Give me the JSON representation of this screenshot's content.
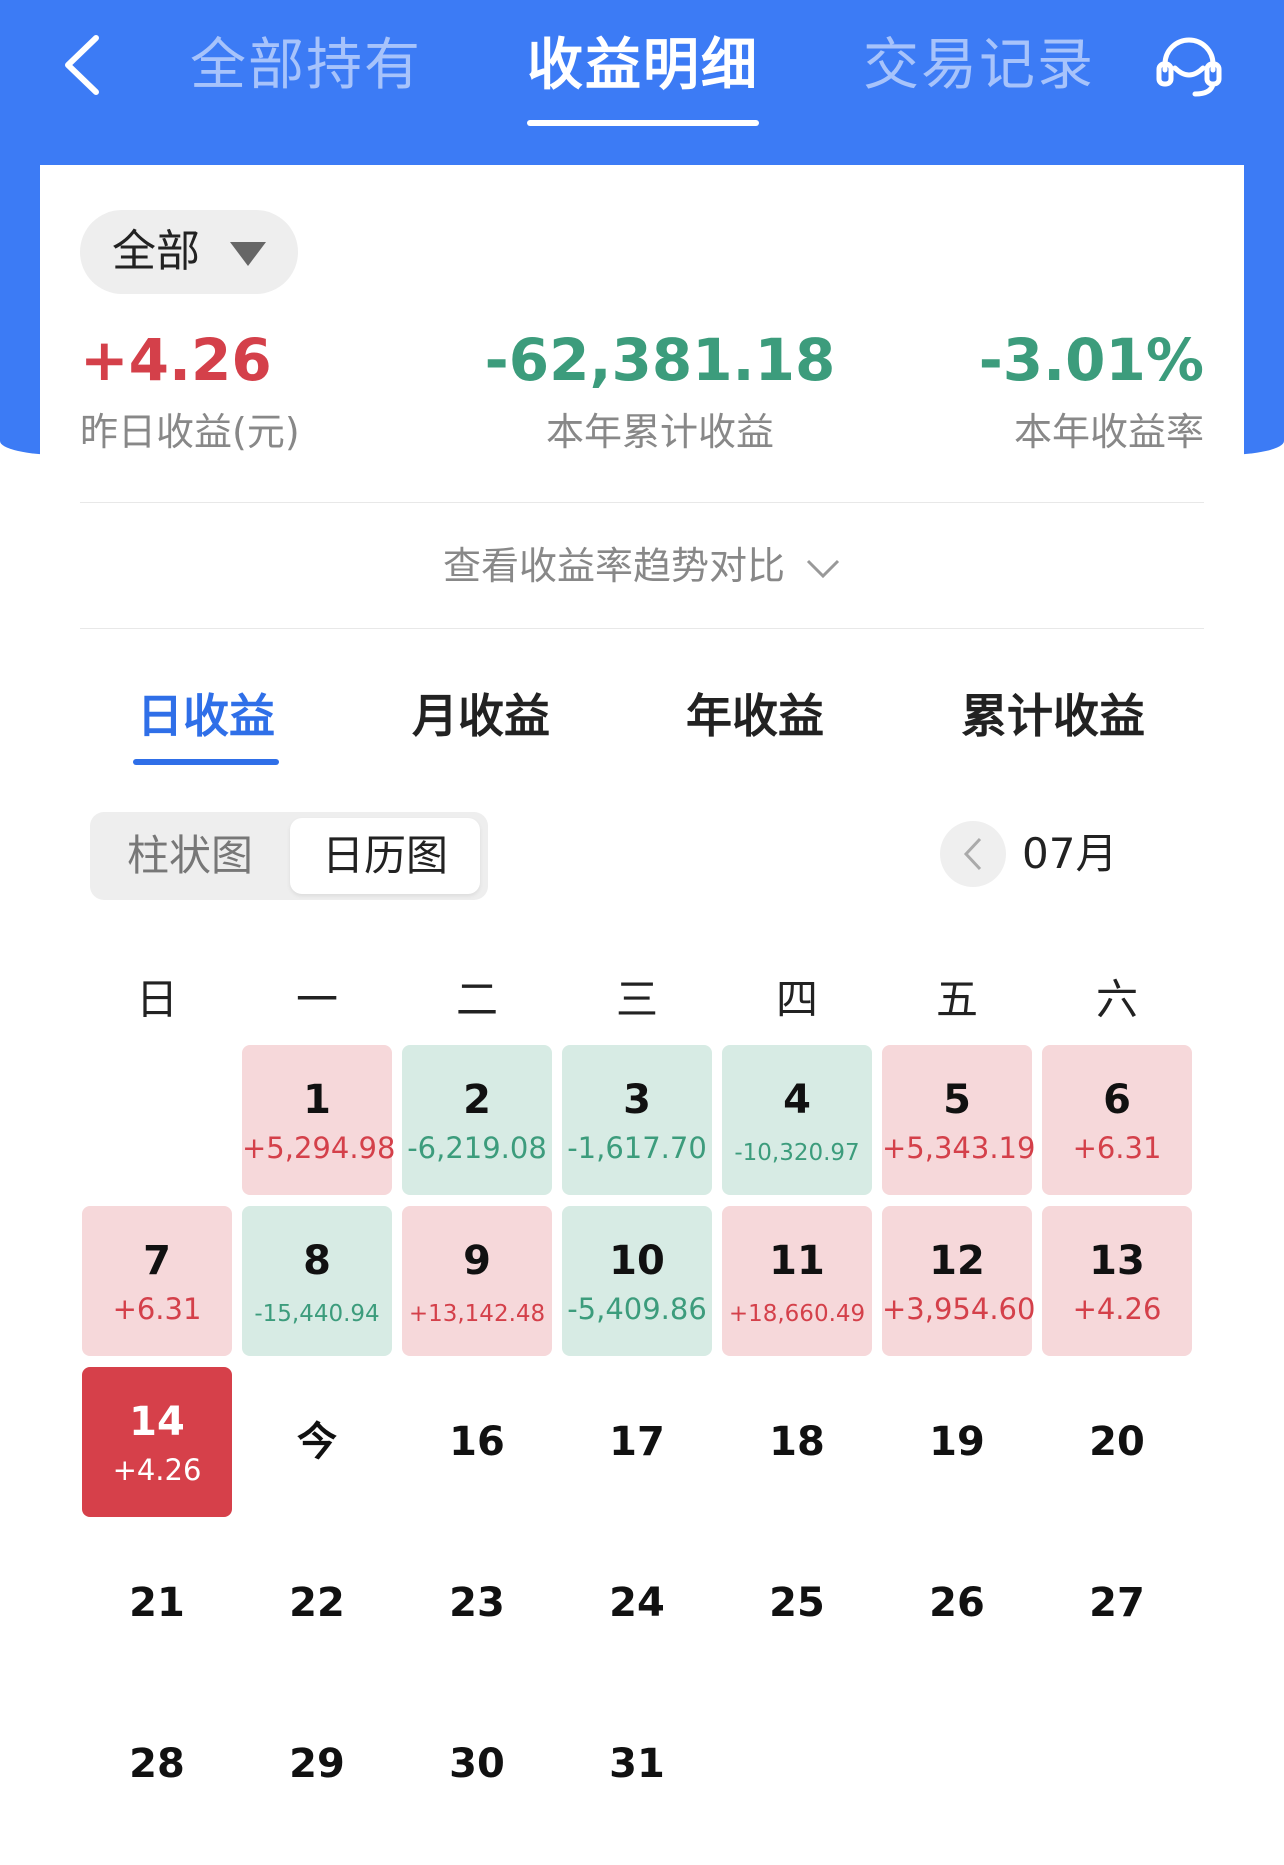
{
  "nav": {
    "tabs": [
      {
        "label": "全部持有"
      },
      {
        "label": "收益明细"
      },
      {
        "label": "交易记录"
      }
    ]
  },
  "filter": {
    "label": "全部"
  },
  "stats": {
    "yesterday": {
      "value": "+4.26",
      "label": "昨日收益(元)"
    },
    "ytd": {
      "value": "-62,381.18",
      "label": "本年累计收益"
    },
    "rate": {
      "value": "-3.01%",
      "label": "本年收益率"
    }
  },
  "trend_link": "查看收益率趋势对比",
  "range_tabs": [
    {
      "label": "日收益"
    },
    {
      "label": "月收益"
    },
    {
      "label": "年收益"
    },
    {
      "label": "累计收益"
    }
  ],
  "view_toggle": {
    "bar": "柱状图",
    "calendar": "日历图"
  },
  "month": "07月",
  "weekdays": [
    "日",
    "一",
    "二",
    "三",
    "四",
    "五",
    "六"
  ],
  "calendar": [
    {
      "day": "1",
      "value": "+5,294.98"
    },
    {
      "day": "2",
      "value": "-6,219.08"
    },
    {
      "day": "3",
      "value": "-1,617.70"
    },
    {
      "day": "4",
      "value": "-10,320.97"
    },
    {
      "day": "5",
      "value": "+5,343.19"
    },
    {
      "day": "6",
      "value": "+6.31"
    },
    {
      "day": "7",
      "value": "+6.31"
    },
    {
      "day": "8",
      "value": "-15,440.94"
    },
    {
      "day": "9",
      "value": "+13,142.48"
    },
    {
      "day": "10",
      "value": "-5,409.86"
    },
    {
      "day": "11",
      "value": "+18,660.49"
    },
    {
      "day": "12",
      "value": "+3,954.60"
    },
    {
      "day": "13",
      "value": "+4.26"
    },
    {
      "day": "14",
      "value": "+4.26"
    },
    {
      "day": "今",
      "value": ""
    },
    {
      "day": "16",
      "value": ""
    },
    {
      "day": "17",
      "value": ""
    },
    {
      "day": "18",
      "value": ""
    },
    {
      "day": "19",
      "value": ""
    },
    {
      "day": "20",
      "value": ""
    },
    {
      "day": "21",
      "value": ""
    },
    {
      "day": "22",
      "value": ""
    },
    {
      "day": "23",
      "value": ""
    },
    {
      "day": "24",
      "value": ""
    },
    {
      "day": "25",
      "value": ""
    },
    {
      "day": "26",
      "value": ""
    },
    {
      "day": "27",
      "value": ""
    },
    {
      "day": "28",
      "value": ""
    },
    {
      "day": "29",
      "value": ""
    },
    {
      "day": "30",
      "value": ""
    },
    {
      "day": "31",
      "value": ""
    }
  ],
  "colors": {
    "brand_blue": "#3c7bf5",
    "gain_red": "#d4404a",
    "loss_green": "#3c9c7c",
    "gain_bg": "#f6d8da",
    "loss_bg": "#d7ebe4",
    "selected_day_bg": "#d6404a"
  },
  "icons": {
    "back": "chevron-left-icon",
    "service": "headset-icon",
    "filter": "triangle-down-icon",
    "trend": "chevron-down-icon",
    "prev_month": "chevron-left-icon"
  }
}
